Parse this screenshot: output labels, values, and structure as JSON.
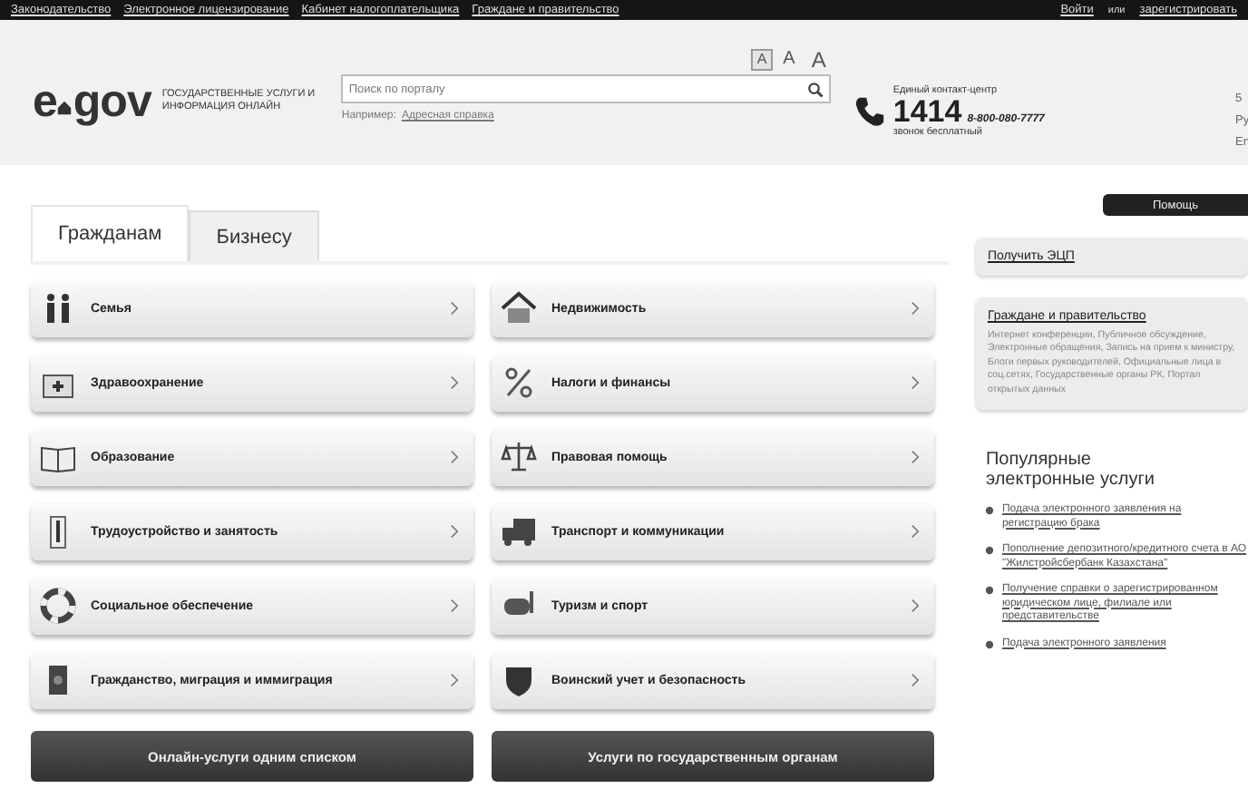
{
  "top_bar": {
    "links": [
      "Законодательство",
      "Электронное лицензирование",
      "Кабинет налогоплательщика",
      "Граждане и правительство"
    ],
    "login": "Войти",
    "or": "или",
    "register": "зарегистрировать"
  },
  "header": {
    "logo_left": "e",
    "logo_right": "gov",
    "tagline": "ГОСУДАРСТВЕННЫЕ УСЛУГИ И ИНФОРМАЦИЯ ОНЛАЙН",
    "search": {
      "placeholder": "Поиск по порталу"
    },
    "example_label": "Например:",
    "example_link": "Адресная справка",
    "font_sizes": [
      {
        "label": "A",
        "selected": true
      },
      {
        "label": "A",
        "selected": false
      },
      {
        "label": "A",
        "selected": false
      }
    ],
    "contact": {
      "title": "Единый контакт-центр",
      "number": "1414",
      "alt_number": "8-800-080-7777",
      "note": "звонок бесплатный"
    },
    "edge_texts": [
      "5",
      "Ру",
      "En"
    ]
  },
  "tabs": [
    {
      "label": "Гражданам",
      "selected": true
    },
    {
      "label": "Бизнесу",
      "selected": false
    }
  ],
  "categories": [
    {
      "label": "Семья"
    },
    {
      "label": "Недвижимость"
    },
    {
      "label": "Здравоохранение"
    },
    {
      "label": "Налоги и финансы"
    },
    {
      "label": "Образование"
    },
    {
      "label": "Правовая помощь"
    },
    {
      "label": "Трудоустройство и занятость"
    },
    {
      "label": "Транспорт и коммуникации"
    },
    {
      "label": "Социальное обеспечение"
    },
    {
      "label": "Туризм и спорт"
    },
    {
      "label": "Гражданство, миграция и иммиграция"
    },
    {
      "label": "Воинский учет и безопасность"
    }
  ],
  "bottom_buttons": [
    "Онлайн-услуги одним списком",
    "Услуги по государственным органам"
  ],
  "sidebar": {
    "help_button": "Помощь",
    "ecp_link": "Получить ЭЦП",
    "gov_card": {
      "title": "Граждане и правительство",
      "text": "Интернет конференции, Публичное обсуждение, Электронные обращения, Запись на прием к министру, Блоги первых руководителей, Официальные лица в соц.сетях, Государственные органы РК, Портал открытых данных"
    },
    "popular_title": "Популярные электронные услуги",
    "popular": [
      "Подача электронного заявления на регистрацию брака",
      "Пополнение депозитного/кредитного счета в АО \"Жилстройсбербанк Казахстана\"",
      "Получение справки о зарегистрированном юридическом лице, филиале или представительстве",
      "Подача электронного заявления"
    ]
  }
}
